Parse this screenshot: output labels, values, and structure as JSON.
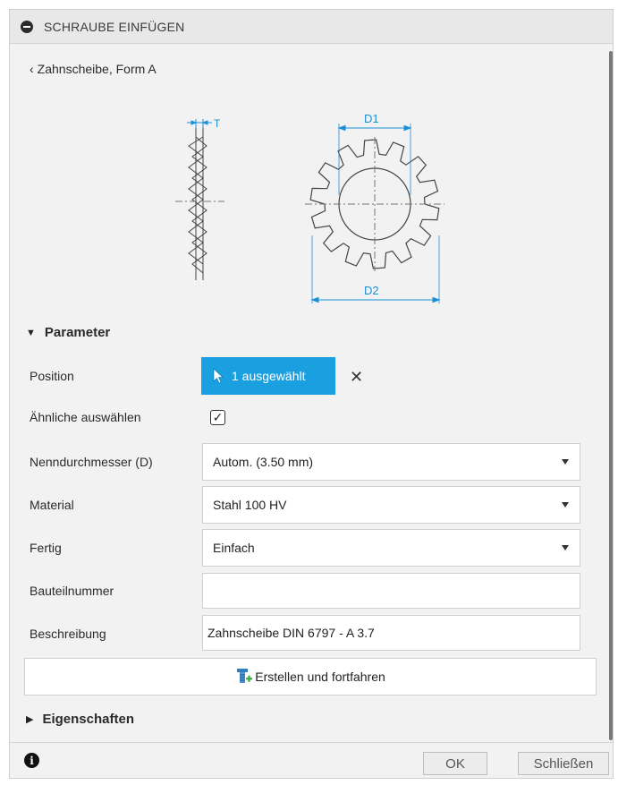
{
  "dialog": {
    "title": "SCHRAUBE EINFÜGEN",
    "back_label": "Zahnscheibe, Form A"
  },
  "illustration": {
    "labels": {
      "t": "T",
      "d1": "D1",
      "d2": "D2"
    },
    "dimension_color": "#1a8fd6"
  },
  "parameter_section": {
    "label": "Parameter",
    "position": {
      "label": "Position",
      "button_label": "1 ausgewählt"
    },
    "similar": {
      "label": "Ähnliche auswählen",
      "checked": true
    },
    "nominal_diameter": {
      "label": "Nenndurchmesser (D)",
      "value": "Autom. (3.50 mm)"
    },
    "material": {
      "label": "Material",
      "value": "Stahl 100 HV"
    },
    "finish": {
      "label": "Fertig",
      "value": "Einfach"
    },
    "part_number": {
      "label": "Bauteilnummer",
      "value": ""
    },
    "description": {
      "label": "Beschreibung",
      "value": "Zahnscheibe DIN 6797 - A 3.7"
    }
  },
  "create_button": {
    "label": "Erstellen und fortfahren"
  },
  "properties_section": {
    "label": "Eigenschaften"
  },
  "footer": {
    "ok_label": "OK",
    "close_label": "Schließen"
  },
  "colors": {
    "accent": "#1aa0e0",
    "icon_green": "#3fb24a"
  }
}
